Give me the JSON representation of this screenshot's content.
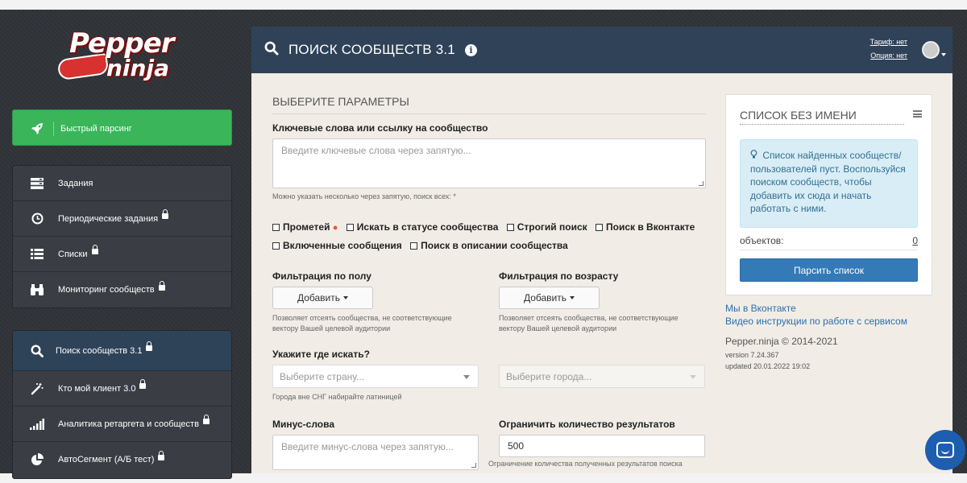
{
  "logo": {
    "line1": "Pepper",
    "line2": "ninja"
  },
  "sidebar": {
    "quick": {
      "label": "Быстрый парсинг",
      "icon": "rocket-icon"
    },
    "group1": [
      {
        "label": "Задания",
        "icon": "tasks-icon",
        "locked": false
      },
      {
        "label": "Периодические задания",
        "icon": "clock-icon",
        "locked": true
      },
      {
        "label": "Списки",
        "icon": "list-icon",
        "locked": true
      },
      {
        "label": "Мониторинг сообществ",
        "icon": "binoculars-icon",
        "locked": true
      }
    ],
    "group2": [
      {
        "label": "Поиск сообществ 3.1",
        "icon": "search-icon",
        "locked": true,
        "active": true
      },
      {
        "label": "Кто мой клиент 3.0",
        "icon": "magic-wand-icon",
        "locked": true
      },
      {
        "label": "Аналитика ретаргета и сообществ",
        "icon": "bar-chart-icon",
        "locked": true
      },
      {
        "label": "АвтоСегмент (А/Б тест)",
        "icon": "pie-chart-icon",
        "locked": true
      }
    ]
  },
  "header": {
    "title": "ПОИСК СООБЩЕСТВ 3.1",
    "info": "i",
    "tariff": "Тариф: нет",
    "option": "Опция: нет"
  },
  "form": {
    "section_title": "ВЫБЕРИТЕ ПАРАМЕТРЫ",
    "keywords_label": "Ключевые слова или ссылку на сообщество",
    "keywords_placeholder": "Введите ключевые слова через запятую...",
    "keywords_hint": "Можно указать несколько через запятую, поиск всех: *",
    "checkboxes": {
      "promoted": "Прометей",
      "status": "Искать в статусе сообщества",
      "strict": "Строгий поиск",
      "vk": "Поиск в Вконтакте",
      "messages": "Включенные сообщения",
      "description": "Поиск в описании сообщества"
    },
    "gender_label": "Фильтрация по полу",
    "age_label": "Фильтрация по возрасту",
    "add_button": "Добавить",
    "filter_hint": "Позволяет отсеять сообщества, не соответствующие вектору Вашей целевой аудитории",
    "where_label": "Укажите где искать?",
    "country_placeholder": "Выберите страну...",
    "city_placeholder": "Выберите города...",
    "where_hint": "Города вне СНГ набирайте латиницей",
    "minus_label": "Минус-слова",
    "minus_placeholder": "Введите минус-слова через запятую...",
    "limit_label": "Ограничить количество результатов",
    "limit_value": "500",
    "limit_hint": "Ограничение количества полученных результатов поиска"
  },
  "card": {
    "title": "СПИСОК БЕЗ ИМЕНИ",
    "alert": "Список найденных сообществ/пользователей пуст. Воспользуйся поиском сообществ, чтобы добавить их сюда и начать работать с ними.",
    "objects_label": "объектов:",
    "objects_count": "0",
    "parse_button": "Парсить список"
  },
  "links": {
    "vk": "Мы в Вконтакте",
    "video": "Видео инструкции по работе с сервисом"
  },
  "meta": {
    "copyright": "Pepper.ninja © 2014-2021",
    "version": "version 7.24.367",
    "updated": "updated 20.01.2022 19:02"
  },
  "colors": {
    "sidebar_bg": "#3a3e44",
    "quick_green": "#3ab55a",
    "header_bg": "#2f4258",
    "primary_button": "#337ab7",
    "chat_button": "#1d5eb0"
  }
}
